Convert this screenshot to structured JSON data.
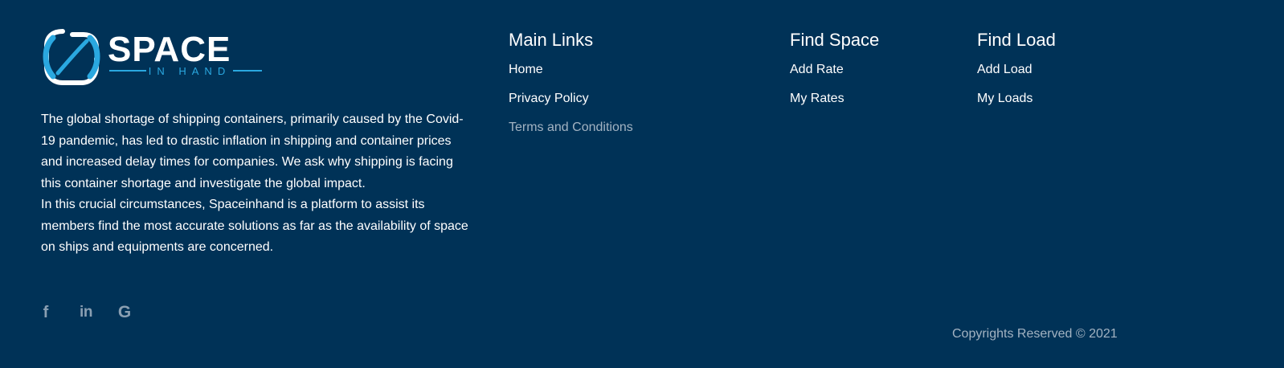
{
  "logo": {
    "name": "SPACE",
    "tagline": "IN HAND",
    "accent_color": "#2aa8e0"
  },
  "about": {
    "paragraph_1": "The global shortage of shipping containers, primarily caused by the Covid-19 pandemic, has led to drastic inflation in shipping and container prices and increased delay times for companies. We ask why shipping is facing this container shortage and investigate the global impact.",
    "paragraph_2": "In this crucial circumstances, Spaceinhand is a platform to assist its members find the most accurate solutions as far as the availability of space on ships and equipments are concerned."
  },
  "social": {
    "facebook_glyph": "f",
    "linkedin_glyph": "in",
    "google_glyph": "G",
    "icon_color": "#8a9fb2"
  },
  "main_links": {
    "title": "Main Links",
    "items": [
      {
        "label": "Home"
      },
      {
        "label": "Privacy Policy"
      },
      {
        "label": "Terms and Conditions"
      }
    ]
  },
  "find_space": {
    "title": "Find Space",
    "items": [
      {
        "label": "Add Rate"
      },
      {
        "label": "My Rates"
      }
    ]
  },
  "find_load": {
    "title": "Find Load",
    "items": [
      {
        "label": "Add Load"
      },
      {
        "label": "My Loads"
      }
    ]
  },
  "copyright": "Copyrights Reserved © 2021",
  "colors": {
    "background": "#003257",
    "text": "#ffffff",
    "muted_text": "#a3b3c2"
  }
}
